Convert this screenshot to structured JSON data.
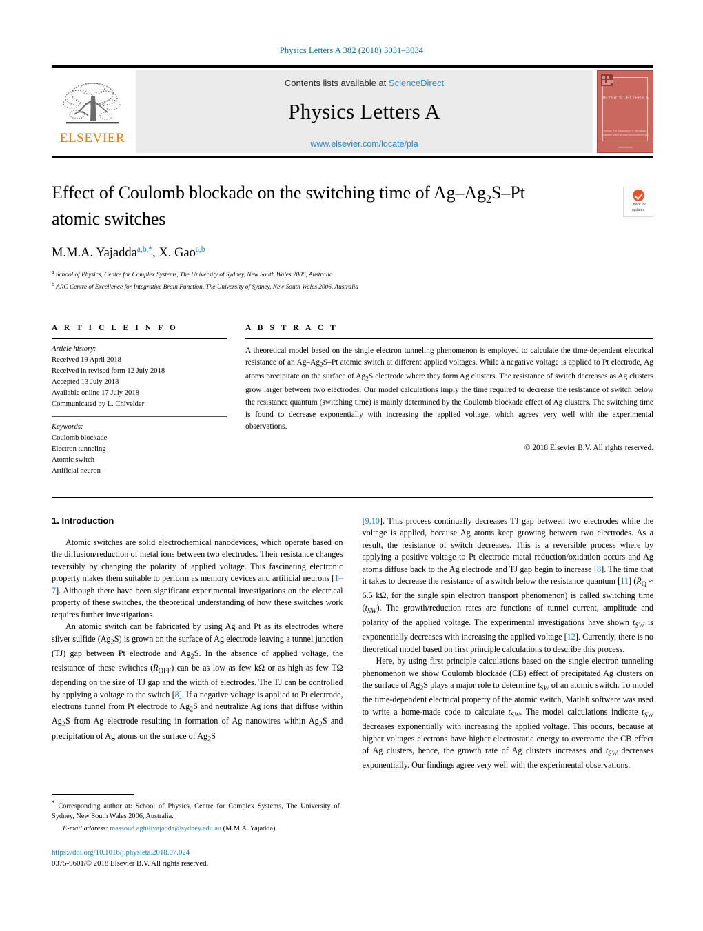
{
  "running_head": "Physics Letters A 382 (2018) 3031–3034",
  "masthead": {
    "publisher_name": "ELSEVIER",
    "contents_prefix": "Contents lists available at ",
    "contents_link": "ScienceDirect",
    "journal_title": "Physics Letters A",
    "journal_url": "www.elsevier.com/locate/pla",
    "cover": {
      "title": "PHYSICS LETTERS A",
      "foot_line1": "Editors: V.M. Agranovich, H. Nishikawa",
      "foot_line2": "Available online at www.sciencedirect.com",
      "band": "ScienceDirect"
    }
  },
  "article": {
    "title_line1": "Effect of Coulomb blockade on the switching time of Ag–Ag",
    "title_sub": "2",
    "title_line1b": "S–Pt",
    "title_line2": "atomic switches",
    "authors": [
      {
        "name": "M.M.A. Yajadda",
        "marks": "a,b,",
        "star": "*"
      },
      {
        "name": "X. Gao",
        "marks": "a,b",
        "star": ""
      }
    ],
    "affiliations": [
      {
        "mark": "a",
        "text": "School of Physics, Centre for Complex Systems, The University of Sydney, New South Wales 2006, Australia"
      },
      {
        "mark": "b",
        "text": "ARC Centre of Excellence for Integrative Brain Function, The University of Sydney, New South Wales 2006, Australia"
      }
    ],
    "crossmark": {
      "line1": "Check for",
      "line2": "updates"
    }
  },
  "info": {
    "heading": "A R T I C L E   I N F O",
    "history_label": "Article history:",
    "history": [
      "Received 19 April 2018",
      "Received in revised form 12 July 2018",
      "Accepted 13 July 2018",
      "Available online 17 July 2018",
      "Communicated by L. Chivelder"
    ],
    "keywords_label": "Keywords:",
    "keywords": [
      "Coulomb blockade",
      "Electron tunneling",
      "Atomic switch",
      "Artificial neuron"
    ]
  },
  "abstract": {
    "heading": "A B S T R A C T",
    "text": "A theoretical model based on the single electron tunneling phenomenon is employed to calculate the time-dependent electrical resistance of an Ag–Ag2S–Pt atomic switch at different applied voltages. While a negative voltage is applied to Pt electrode, Ag atoms precipitate on the surface of Ag2S electrode where they form Ag clusters. The resistance of switch decreases as Ag clusters grow larger between two electrodes. Our model calculations imply the time required to decrease the resistance of switch below the resistance quantum (switching time) is mainly determined by the Coulomb blockade effect of Ag clusters. The switching time is found to decrease exponentially with increasing the applied voltage, which agrees very well with the experimental observations.",
    "copyright": "© 2018 Elsevier B.V. All rights reserved."
  },
  "body": {
    "section_heading": "1. Introduction",
    "left_paragraphs": [
      "Atomic switches are solid electrochemical nanodevices, which operate based on the diffusion/reduction of metal ions between two electrodes. Their resistance changes reversibly by changing the polarity of applied voltage. This fascinating electronic property makes them suitable to perform as memory devices and artificial neurons [1–7]. Although there have been significant experimental investigations on the electrical property of these switches, the theoretical understanding of how these switches work requires further investigations.",
      "An atomic switch can be fabricated by using Ag and Pt as its electrodes where silver sulfide (Ag2S) is grown on the surface of Ag electrode leaving a tunnel junction (TJ) gap between Pt electrode and Ag2S. In the absence of applied voltage, the resistance of these switches (ROFF) can be as low as few kΩ or as high as few TΩ depending on the size of TJ gap and the width of electrodes. The TJ can be controlled by applying a voltage to the switch [8]. If a negative voltage is applied to Pt electrode, electrons tunnel from Pt electrode to Ag2S and neutralize Ag ions that diffuse within Ag2S from Ag electrode resulting in formation of Ag nanowires within Ag2S and precipitation of Ag atoms on the surface of Ag2S"
    ],
    "right_paragraphs": [
      "[9,10]. This process continually decreases TJ gap between two electrodes while the voltage is applied, because Ag atoms keep growing between two electrodes. As a result, the resistance of switch decreases. This is a reversible process where by applying a positive voltage to Pt electrode metal reduction/oxidation occurs and Ag atoms diffuse back to the Ag electrode and TJ gap begin to increase [8]. The time that it takes to decrease the resistance of a switch below the resistance quantum [11] (RQ ≈ 6.5 kΩ, for the single spin electron transport phenomenon) is called switching time (tSW). The growth/reduction rates are functions of tunnel current, amplitude and polarity of the applied voltage. The experimental investigations have shown tSW is exponentially decreases with increasing the applied voltage [12]. Currently, there is no theoretical model based on first principle calculations to describe this process.",
      "Here, by using first principle calculations based on the single electron tunneling phenomenon we show Coulomb blockade (CB) effect of precipitated Ag clusters on the surface of Ag2S plays a major role to determine tSW of an atomic switch. To model the time-dependent electrical property of the atomic switch, Matlab software was used to write a home-made code to calculate tSW. The model calculations indicate tSW decreases exponentially with increasing the applied voltage. This occurs, because at higher voltages electrons have higher electrostatic energy to overcome the CB effect of Ag clusters, hence, the growth rate of Ag clusters increases and tSW decreases exponentially. Our findings agree very well with the experimental observations."
    ]
  },
  "footnote": {
    "star": "*",
    "corresponding": "Corresponding author at: School of Physics, Centre for Complex Systems, The University of Sydney, New South Wales 2006, Australia.",
    "email_label": "E-mail address:",
    "email": "massoud.aghiliyajadda@sydney.edu.au",
    "email_owner": "(M.M.A. Yajadda).",
    "doi": "https://doi.org/10.1016/j.physleta.2018.07.024",
    "issn_line": "0375-9601/© 2018 Elsevier B.V. All rights reserved."
  },
  "colors": {
    "link": "#1a7fb5",
    "elsevier_orange": "#f07c00",
    "cover_red": "#c8685e",
    "banner_gray": "#ebebeb"
  }
}
